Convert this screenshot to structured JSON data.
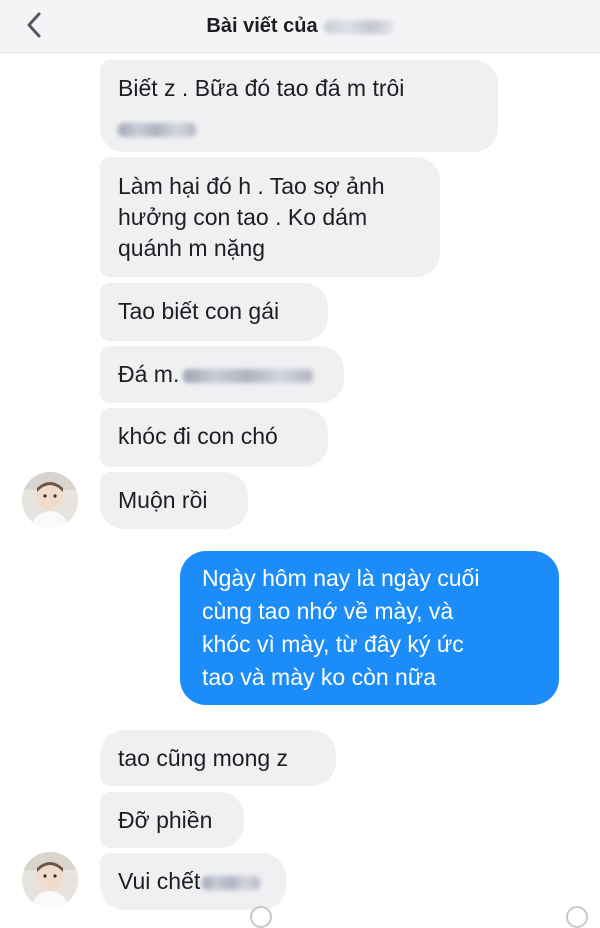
{
  "header": {
    "title": "Bài viết của"
  },
  "messages": [
    {
      "text": "Biết z . Bữa đó tao đá m trôi"
    },
    {
      "lines": [
        "Làm hại đó h . Tao sợ ảnh",
        "hưởng con tao . Ko dám",
        "quánh m nặng"
      ]
    },
    {
      "text": "Tao biết con gái"
    },
    {
      "text": "Đá m."
    },
    {
      "text": "khóc đi con chó"
    },
    {
      "text": "Muộn rồi"
    },
    {
      "lines": [
        "Ngày  hôm nay là ngày cuối",
        "cùng tao nhớ về mày,  và",
        "khóc vì mày,   từ đây ký ức",
        "tao và mày ko còn nữa"
      ]
    },
    {
      "text": "tao cũng mong z"
    },
    {
      "text": "Đỡ phiền"
    },
    {
      "text": "Vui chết"
    }
  ],
  "colors": {
    "incoming_bubble": "#f0f0f3",
    "outgoing_bubble": "#1c8df8",
    "header_bg": "#f4f4f6"
  },
  "icons": {
    "back": "chevron-left-icon",
    "avatar": "contact-avatar-icon"
  }
}
